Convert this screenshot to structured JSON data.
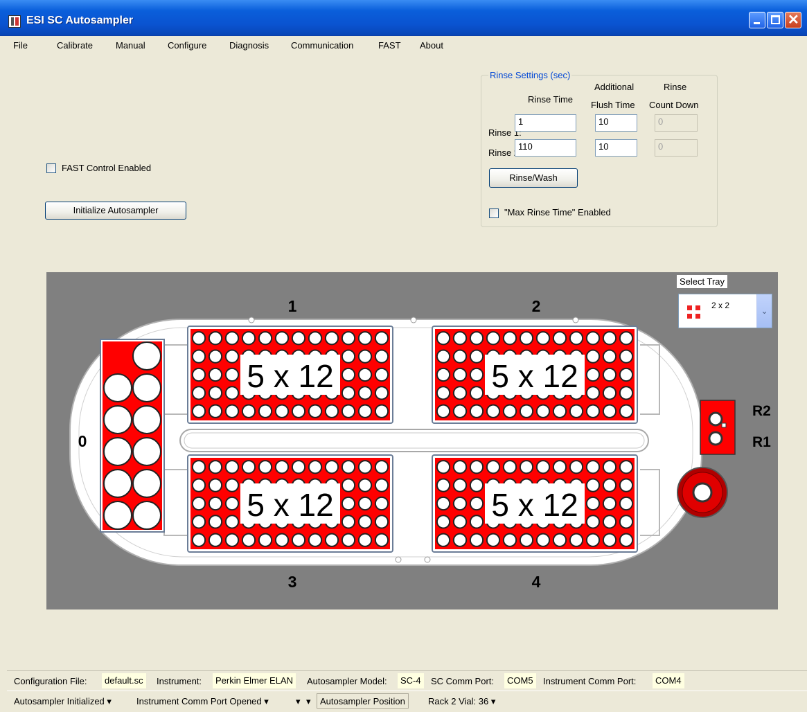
{
  "window": {
    "title": "ESI SC Autosampler"
  },
  "menu": [
    "File",
    "Calibrate",
    "Manual",
    "Configure",
    "Diagnosis",
    "Communication",
    "FAST",
    "About"
  ],
  "controls": {
    "fast_control_label": "FAST Control Enabled",
    "fast_control_checked": false,
    "initialize_button": "Initialize Autosampler"
  },
  "rinse": {
    "group_label": "Rinse Settings (sec)",
    "col_rinse_time": "Rinse Time",
    "col_additional_1": "Additional",
    "col_additional_2": "Flush Time",
    "col_countdown_1": "Rinse",
    "col_countdown_2": "Count Down",
    "rows": [
      {
        "label": "Rinse 1:",
        "rinse_time": "1",
        "flush_time": "10",
        "countdown": "0"
      },
      {
        "label": "Rinse 2:",
        "rinse_time": "110",
        "flush_time": "10",
        "countdown": "0"
      }
    ],
    "wash_button": "Rinse/Wash",
    "max_rinse_label": "\"Max Rinse Time\" Enabled",
    "max_rinse_checked": false
  },
  "tray": {
    "select_label": "Select Tray",
    "selected": "2 x 2",
    "racks": [
      {
        "number": "1",
        "label": "5 x 12"
      },
      {
        "number": "2",
        "label": "5 x 12"
      },
      {
        "number": "3",
        "label": "5 x 12"
      },
      {
        "number": "4",
        "label": "5 x 12"
      }
    ],
    "left_rack_number": "0",
    "rinse_labels": {
      "r2": "R2",
      "r1": "R1"
    },
    "rack_color": "#ff0000"
  },
  "status": {
    "config_label": "Configuration File:",
    "config_value": "default.sc",
    "instrument_label": "Instrument:",
    "instrument_value": "Perkin Elmer ELAN",
    "model_label": "Autosampler Model:",
    "model_value": "SC-4",
    "sc_port_label": "SC Comm Port:",
    "sc_port_value": "COM5",
    "inst_port_label": "Instrument Comm Port:",
    "inst_port_value": "COM4",
    "initialized": "Autosampler Initialized",
    "port_opened": "Instrument Comm Port Opened",
    "position_label": "Autosampler Position",
    "position_value": "Rack 2 Vial: 36"
  }
}
